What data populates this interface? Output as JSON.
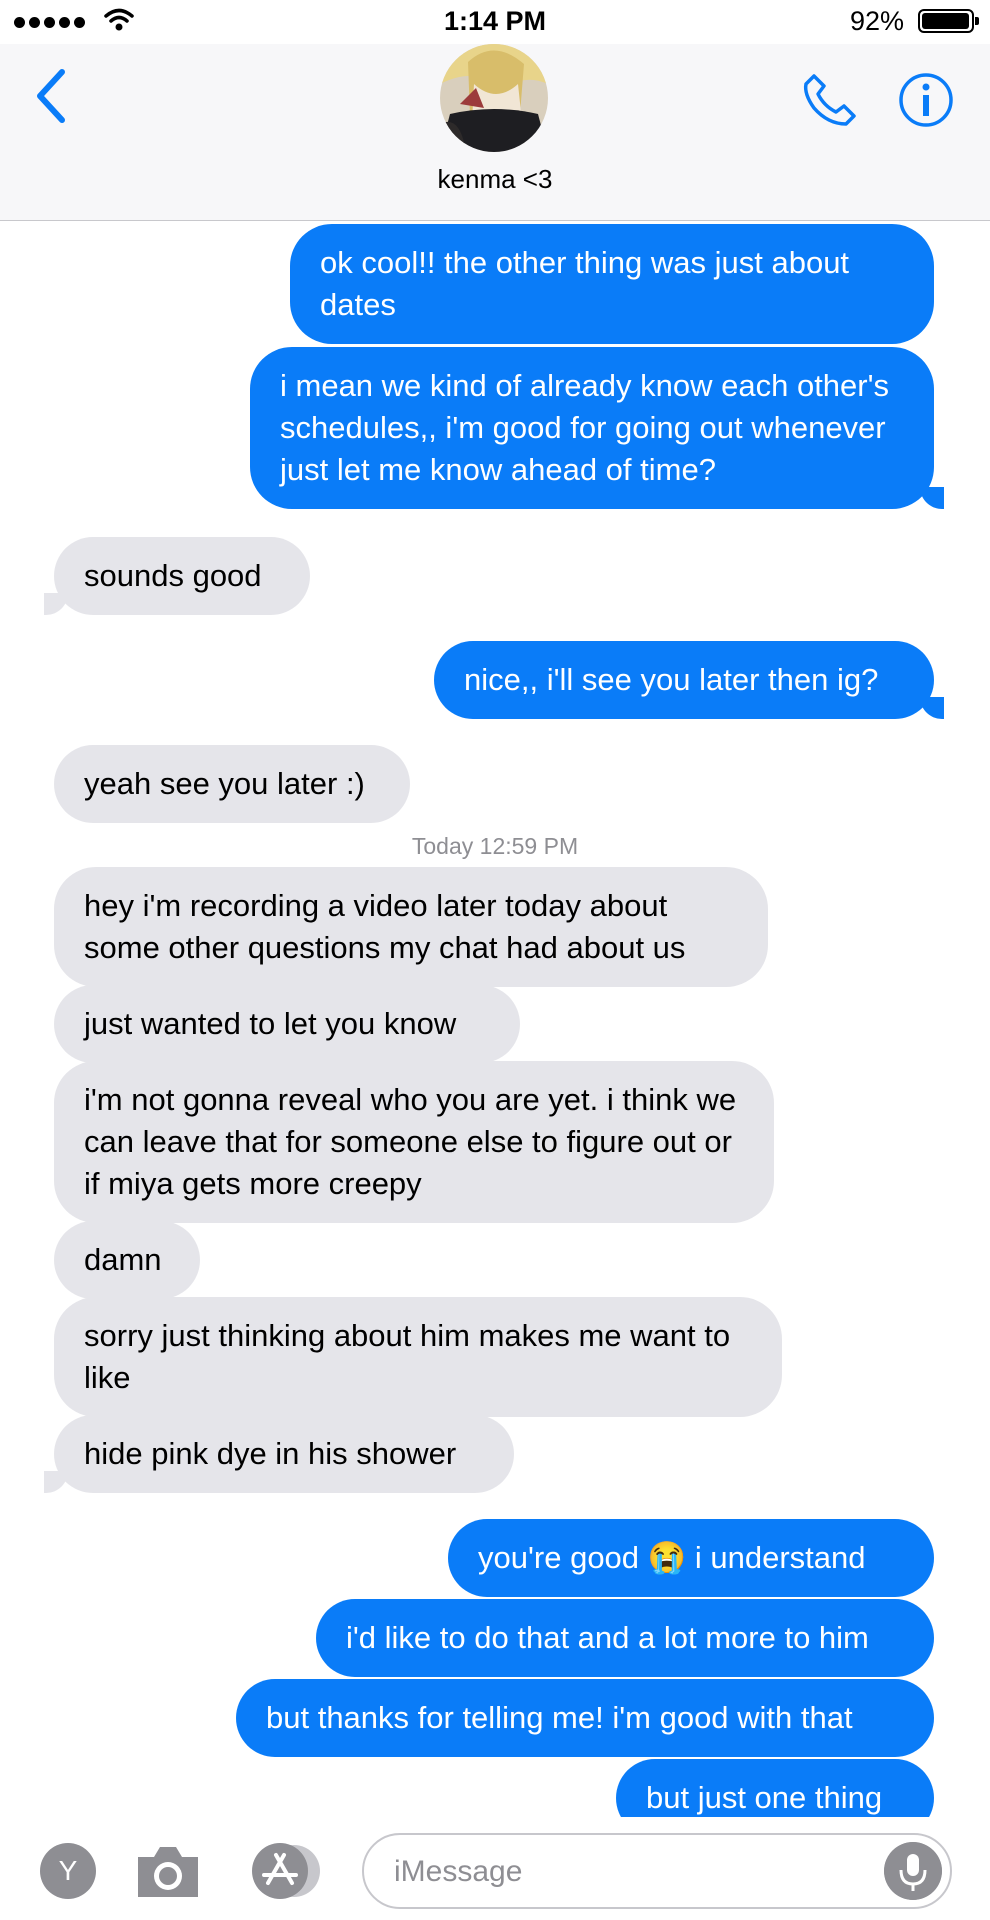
{
  "status_bar": {
    "time": "1:14 PM",
    "battery": "92%"
  },
  "header": {
    "contact_name": "kenma <3"
  },
  "messages": [
    {
      "dir": "out",
      "text": "ok cool!! the other thing was just about dates"
    },
    {
      "dir": "out",
      "text": "i mean we kind of already know each other's schedules,, i'm good for going out whenever just let me know ahead of time?"
    },
    {
      "dir": "in",
      "text": "sounds good"
    },
    {
      "dir": "out",
      "text": "nice,, i'll see you later then ig?"
    },
    {
      "dir": "in",
      "text": "yeah see you later :)"
    },
    {
      "dir": "in",
      "text": "hey i'm recording a video later today about some other questions my chat had about us"
    },
    {
      "dir": "in",
      "text": "just wanted to let you know"
    },
    {
      "dir": "in",
      "text": "i'm not gonna reveal who you are yet. i think we can leave that for someone else to figure out or if miya gets more creepy"
    },
    {
      "dir": "in",
      "text": "damn"
    },
    {
      "dir": "in",
      "text": "sorry just thinking about him makes me want to like"
    },
    {
      "dir": "in",
      "text": "hide pink dye in his shower"
    },
    {
      "dir": "out",
      "text": "you're good 😭 i understand"
    },
    {
      "dir": "out",
      "text": "i'd like to do that and a lot more to him"
    },
    {
      "dir": "out",
      "text": "but thanks for telling me! i'm good with that"
    },
    {
      "dir": "out",
      "text": "but just one thing"
    }
  ],
  "timestamp": "Today 12:59 PM",
  "composer": {
    "placeholder": "iMessage",
    "app_letter": "Y"
  },
  "colors": {
    "outgoing": "#0a7cf8",
    "incoming": "#e5e5ea",
    "accent": "#0a7cf8"
  },
  "icons": [
    "back-chevron-icon",
    "phone-icon",
    "info-icon",
    "camera-icon",
    "app-store-icon",
    "microphone-icon",
    "wifi-icon",
    "battery-icon"
  ]
}
